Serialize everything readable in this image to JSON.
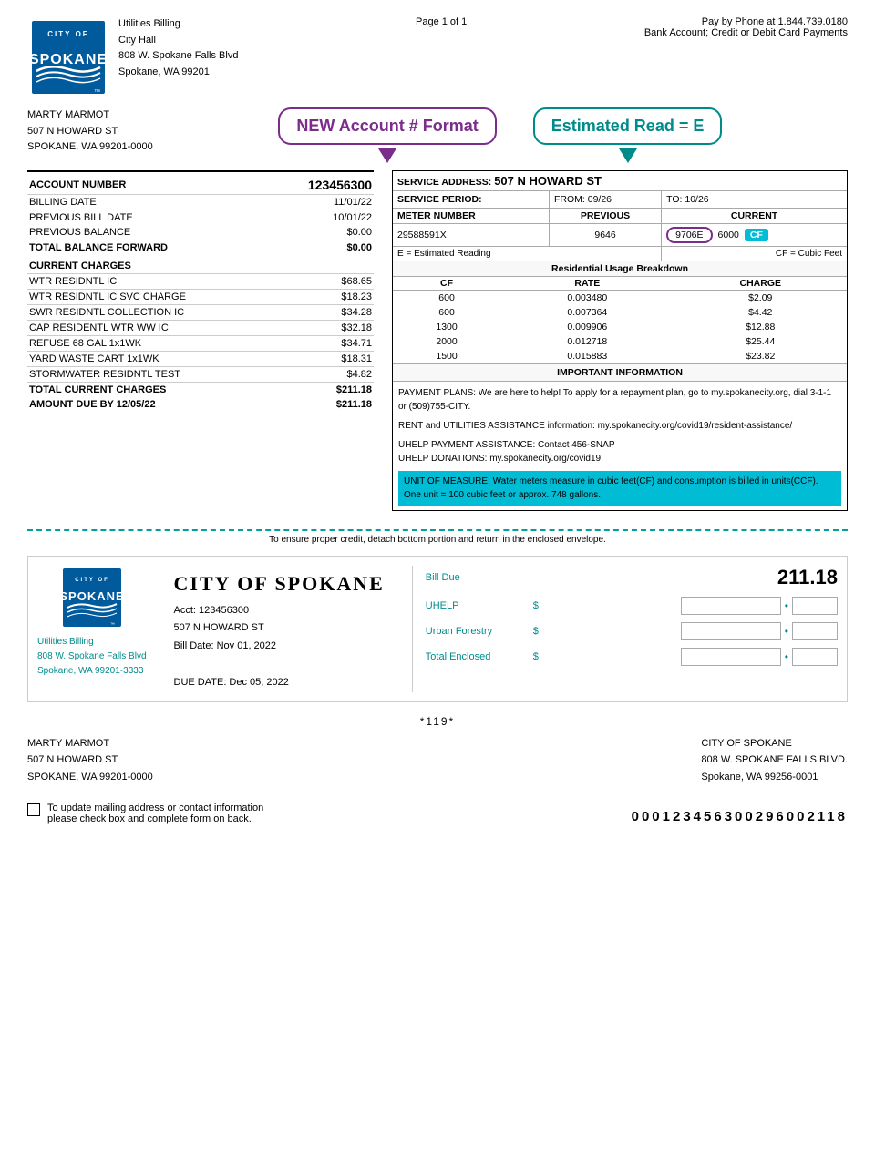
{
  "page": {
    "page_info": "Page 1 of 1",
    "phone_info": "Pay by Phone at 1.844.739.0180",
    "payment_info": "Bank Account; Credit or Debit Card Payments"
  },
  "company": {
    "name": "Utilities Billing",
    "address_line1": "City Hall",
    "address_line2": "808 W. Spokane Falls Blvd",
    "address_line3": "Spokane, WA 99201"
  },
  "customer": {
    "name": "MARTY MARMOT",
    "address1": "507 N HOWARD ST",
    "address2": "SPOKANE, WA 99201-0000"
  },
  "callouts": {
    "account_format": "NEW Account # Format",
    "estimated_read": "Estimated Read = E"
  },
  "billing": {
    "account_number_label": "ACCOUNT NUMBER",
    "account_number_value": "123456300",
    "billing_date_label": "BILLING DATE",
    "billing_date_value": "11/01/22",
    "previous_bill_date_label": "PREVIOUS BILL DATE",
    "previous_bill_date_value": "10/01/22",
    "previous_balance_label": "PREVIOUS BALANCE",
    "previous_balance_value": "$0.00",
    "total_balance_label": "TOTAL BALANCE FORWARD",
    "total_balance_value": "$0.00",
    "current_charges_header": "CURRENT CHARGES",
    "charges": [
      {
        "label": "WTR RESIDNTL IC",
        "amount": "$68.65"
      },
      {
        "label": "WTR RESIDNTL IC SVC CHARGE",
        "amount": "$18.23"
      },
      {
        "label": "SWR RESIDNTL COLLECTION IC",
        "amount": "$34.28"
      },
      {
        "label": "CAP RESIDENTL WTR WW IC",
        "amount": "$32.18"
      },
      {
        "label": "REFUSE 68 GAL 1x1WK",
        "amount": "$34.71"
      },
      {
        "label": "YARD WASTE CART 1x1WK",
        "amount": "$18.31"
      },
      {
        "label": "STORMWATER RESIDNTL TEST",
        "amount": "$4.82"
      }
    ],
    "total_current_label": "TOTAL CURRENT CHARGES",
    "total_current_value": "$211.18",
    "amount_due_label": "AMOUNT DUE BY 12/05/22",
    "amount_due_value": "$211.18"
  },
  "service": {
    "address_label": "SERVICE ADDRESS:",
    "address_value": "507 N HOWARD ST",
    "period_label": "SERVICE PERIOD:",
    "period_from": "FROM: 09/26",
    "period_to": "TO: 10/26",
    "meter_label": "METER NUMBER",
    "previous_label": "PREVIOUS",
    "current_label": "CURRENT",
    "meter_number": "29588591X",
    "previous_reading": "9646",
    "current_reading": "9706E",
    "cf_value": "6000",
    "cf_badge": "CF",
    "estimated_note": "E = Estimated Reading",
    "cf_note": "CF = Cubic Feet",
    "usage_header": "Residential Usage Breakdown",
    "usage_cols": [
      "CF",
      "RATE",
      "CHARGE"
    ],
    "usage_rows": [
      {
        "cf": "600",
        "rate": "0.003480",
        "charge": "$2.09"
      },
      {
        "cf": "600",
        "rate": "0.007364",
        "charge": "$4.42"
      },
      {
        "cf": "1300",
        "rate": "0.009906",
        "charge": "$12.88"
      },
      {
        "cf": "2000",
        "rate": "0.012718",
        "charge": "$25.44"
      },
      {
        "cf": "1500",
        "rate": "0.015883",
        "charge": "$23.82"
      }
    ]
  },
  "important": {
    "header": "IMPORTANT INFORMATION",
    "p1": "PAYMENT PLANS: We are here to help! To apply for a repayment plan, go to my.spokanecity.org, dial 3-1-1 or (509)755-CITY.",
    "p2": "RENT and UTILITIES ASSISTANCE information: my.spokanecity.org/covid19/resident-assistance/",
    "p3": "UHELP PAYMENT ASSISTANCE: Contact 456-SNAP\nUHELP DONATIONS: my.spokanecity.org/covid19",
    "p4_highlight": "UNIT OF MEASURE: Water meters measure in cubic feet(CF) and consumption is billed in units(CCF). One unit = 100 cubic feet or approx. 748 gallons."
  },
  "detach": {
    "text": "To ensure proper credit, detach bottom portion and return in the enclosed envelope."
  },
  "bottom": {
    "billing_name": "Utilities Billing",
    "billing_address1": "808 W. Spokane Falls Blvd",
    "billing_address2": "Spokane, WA 99201-3333",
    "city_title": "CITY OF SPOKANE",
    "acct": "Acct: 123456300",
    "service_address": "507 N HOWARD ST",
    "bill_date": "Bill Date: Nov 01, 2022",
    "due_date": "DUE DATE: Dec 05, 2022",
    "bill_due_label": "Bill Due",
    "bill_due_amount": "211.18",
    "uhelp_label": "UHELP",
    "urban_forestry_label": "Urban Forestry",
    "total_enclosed_label": "Total Enclosed"
  },
  "barcode_number": "*119*",
  "return": {
    "sender_name": "MARTY MARMOT",
    "sender_address1": "507 N HOWARD ST",
    "sender_address2": "SPOKANE, WA 99201-0000",
    "recipient_name": "CITY OF SPOKANE",
    "recipient_address1": "808 W. SPOKANE FALLS BLVD.",
    "recipient_address2": "Spokane, WA 99256-0001"
  },
  "footer": {
    "checkbox_text": "To update mailing address or contact information\nplease check box and complete form on back.",
    "barcode_digits": "000123456300296002118"
  }
}
